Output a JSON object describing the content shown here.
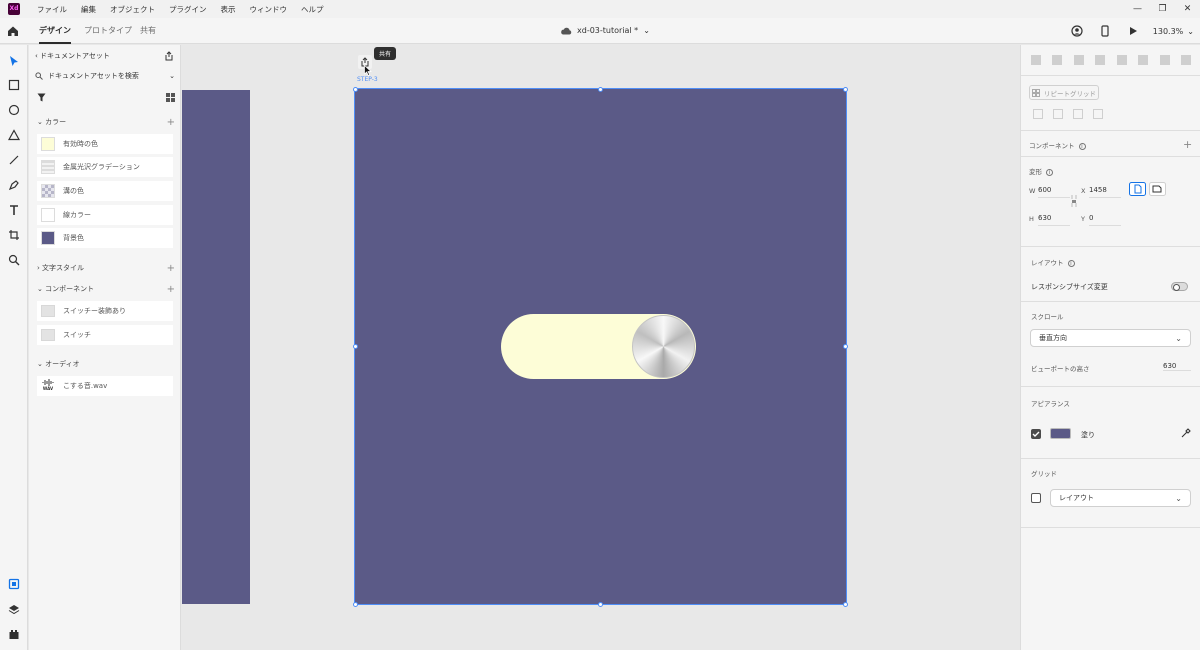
{
  "app": {
    "logo_text": "Xd"
  },
  "menu": [
    "ファイル",
    "編集",
    "オブジェクト",
    "プラグイン",
    "表示",
    "ウィンドウ",
    "ヘルプ"
  ],
  "header": {
    "tabs": [
      "デザイン",
      "プロトタイプ",
      "共有"
    ],
    "active_tab": "デザイン",
    "doc_title": "xd-03-tutorial *",
    "zoom": "130.3%"
  },
  "assets": {
    "back_label": "ドキュメントアセット",
    "search_placeholder": "ドキュメントアセットを検索",
    "colors_header": "カラー",
    "colors": [
      {
        "label": "有効時の色",
        "hex": "#fdfdd7"
      },
      {
        "label": "金属光沢グラデーション",
        "hex": "#d9d9d9"
      },
      {
        "label": "溝の色",
        "hex": "#b7b6c9"
      },
      {
        "label": "線カラー",
        "hex": "#ffffff"
      },
      {
        "label": "背景色",
        "hex": "#5b5a87"
      }
    ],
    "text_styles_header": "文字スタイル",
    "components_header": "コンポーネント",
    "components": [
      "スイッチー装飾あり",
      "スイッチ"
    ],
    "audio_header": "オーディオ",
    "audio": [
      {
        "label": "こする音.wav",
        "badge": "WAV"
      }
    ]
  },
  "canvas": {
    "tooltip": "共有",
    "artboard_label": "STEP-3",
    "background_color": "#5b5a87"
  },
  "props": {
    "repeat_grid": "リピートグリッド",
    "component_label": "コンポーネント",
    "transform_label": "変形",
    "w_label": "W",
    "w": "600",
    "x_label": "X",
    "x": "1458",
    "h_label": "H",
    "h": "630",
    "y_label": "Y",
    "y": "0",
    "layout_label": "レイアウト",
    "responsive_label": "レスポンシブサイズ変更",
    "responsive_on": false,
    "scroll_label": "スクロール",
    "scroll_value": "垂直方向",
    "viewport_label": "ビューポートの高さ",
    "viewport_value": "630",
    "appearance_label": "アピアランス",
    "fill_label": "塗り",
    "fill_checked": true,
    "fill_color": "#5b5a87",
    "grid_label": "グリッド",
    "grid_value": "レイアウト"
  }
}
